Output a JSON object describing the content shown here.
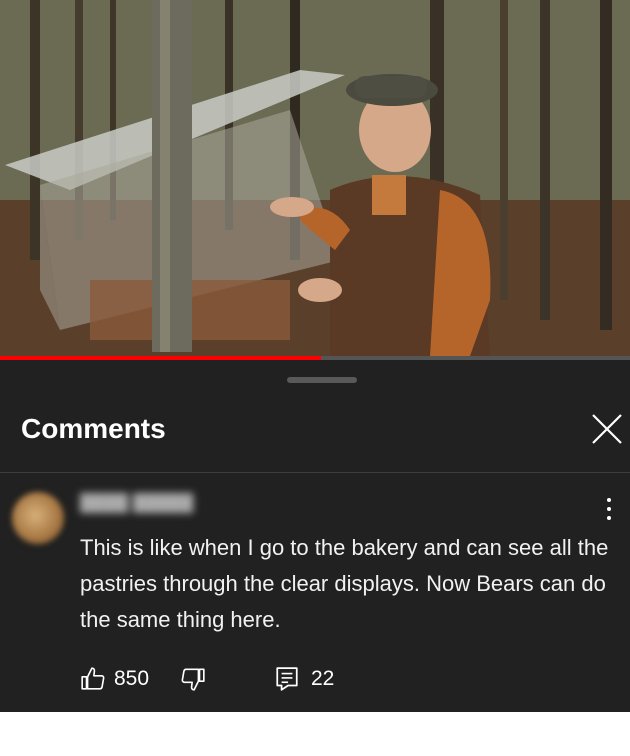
{
  "video": {
    "progress_fraction": 0.51
  },
  "comments_panel": {
    "title": "Comments",
    "close_icon": "close-icon"
  },
  "comment": {
    "author": "████ █████",
    "text": "This is like when I go to the bakery and can see all the pastries through the clear displays. Now Bears can do the same thing here.",
    "like_count": "850",
    "reply_count": "22",
    "icons": {
      "like": "thumbs-up-icon",
      "dislike": "thumbs-down-icon",
      "reply": "reply-icon",
      "more": "more-vert-icon"
    }
  },
  "colors": {
    "background": "#212121",
    "accent": "#ff0000",
    "text": "#f1f1f1"
  }
}
